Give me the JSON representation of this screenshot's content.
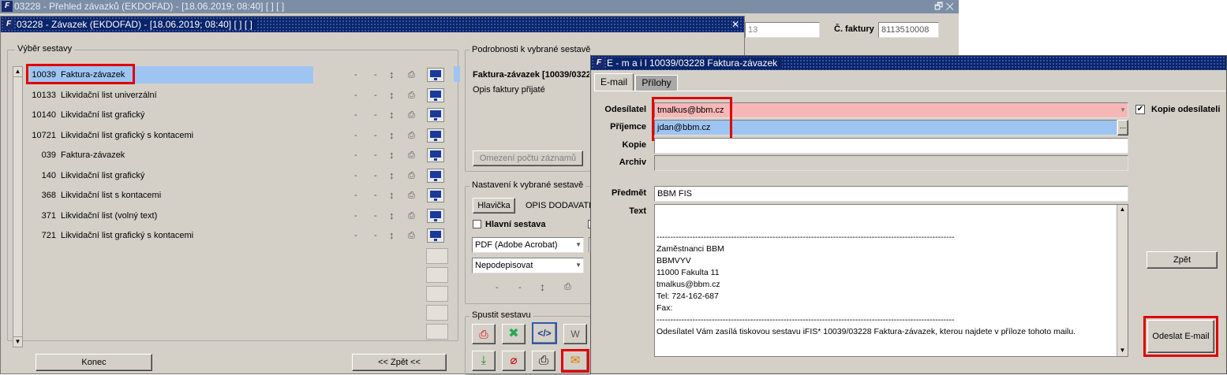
{
  "bg_window": {
    "title": "03228 - Přehled závazků (EKDOFAD) - [18.06.2019; 08:40]   [ ]   [ ]",
    "field1": "13",
    "invoice_label": "Č. faktury",
    "invoice_value": "8113510008"
  },
  "dialog": {
    "title": "03228 - Závazek (EKDOFAD) - [18.06.2019; 08:40]   [ ]   [ ]",
    "report_group": "Výběr sestavy",
    "reports": [
      {
        "code": "10039",
        "name": "Faktura-závazek"
      },
      {
        "code": "10133",
        "name": "Likvidační list univerzální"
      },
      {
        "code": "10140",
        "name": "Likvidační list grafický"
      },
      {
        "code": "10721",
        "name": "Likvidační list grafický s kontacemi"
      },
      {
        "code": "039",
        "name": "Faktura-závazek"
      },
      {
        "code": "140",
        "name": "Likvidační list grafický"
      },
      {
        "code": "368",
        "name": "Likvidační list s kontacemi"
      },
      {
        "code": "371",
        "name": "Likvidační list (volný text)"
      },
      {
        "code": "721",
        "name": "Likvidační list grafický s kontacemi"
      }
    ],
    "dash": "-",
    "details_group": "Podrobnosti k vybrané sestavě",
    "details_title": "Faktura-závazek [10039/0322",
    "details_desc": "Opis faktury přijaté",
    "limit_button": "Omezení počtu záznamů",
    "settings_group": "Nastavení k vybrané sestavě",
    "header_button": "Hlavička",
    "header_value": "OPIS DODAVATE",
    "main_report_label": "Hlavní sestava",
    "format_select": "PDF (Adobe Acrobat)",
    "sign_select": "Nepodepisovat",
    "run_group": "Spustit sestavu",
    "end_button": "Konec",
    "back_button": "<< Zpět <<"
  },
  "mail": {
    "title": "E - m a i l   10039/03228 Faktura-závazek",
    "tabs": [
      "E-mail",
      "Přílohy"
    ],
    "sender_label": "Odesílatel",
    "sender_value": "tmalkus@bbm.cz",
    "recipient_label": "Příjemce",
    "recipient_value": "jdan@bbm.cz",
    "copy_label": "Kopie",
    "archive_label": "Archiv",
    "subject_label": "Předmět",
    "subject_value": "BBM FIS",
    "text_label": "Text",
    "copy_sender_label": "Kopie odesílateli",
    "body_lines": [
      "------------------------------------------------------------------------------------------------------------",
      "Zaměstnanci BBM",
      "BBMVYV",
      "11000 Fakulta 11",
      "tmalkus@bbm.cz",
      "Tel: 724-162-687",
      "Fax:",
      "------------------------------------------------------------------------------------------------------------",
      "Odesílatel Vám zasílá tiskovou sestavu iFIS* 10039/03228 Faktura-závazek, kterou najdete v příloze tohoto mailu."
    ],
    "back_button": "Zpět",
    "send_button": "Odeslat E-mail",
    "ellipsis": "...",
    "checkmark": "✔"
  }
}
